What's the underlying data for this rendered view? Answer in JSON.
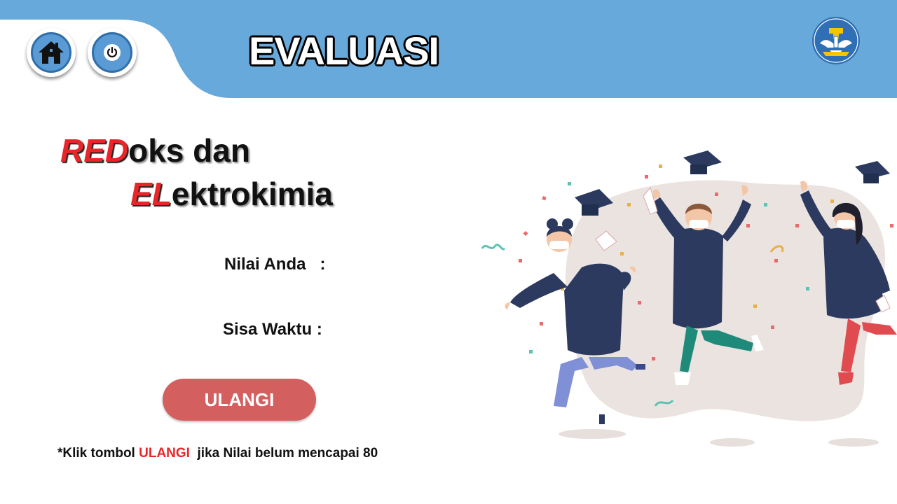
{
  "header": {
    "title": "EVALUASI",
    "band_color": "#68a9db",
    "home_icon": "home-icon",
    "power_icon": "power-icon",
    "emblem_text": "TUT WURI HANDAYANI",
    "emblem_icon": "tut-wuri-handayani-emblem"
  },
  "subject": {
    "line1_highlight": "RED",
    "line1_rest": "oks dan",
    "line2_highlight": "EL",
    "line2_rest": "ektrokimia",
    "highlight_color": "#e8262a"
  },
  "score": {
    "label": "Nilai Anda   :"
  },
  "timer": {
    "label": "Sisa Waktu :"
  },
  "retry_button": {
    "label": "ULANGI",
    "color": "#d45f5f"
  },
  "note": {
    "prefix": "*Klik tombol ",
    "keyword": "ULANGI",
    "suffix": "  jika Nilai belum mencapai 80"
  },
  "illustration": {
    "icon": "graduation-celebration-illustration"
  }
}
